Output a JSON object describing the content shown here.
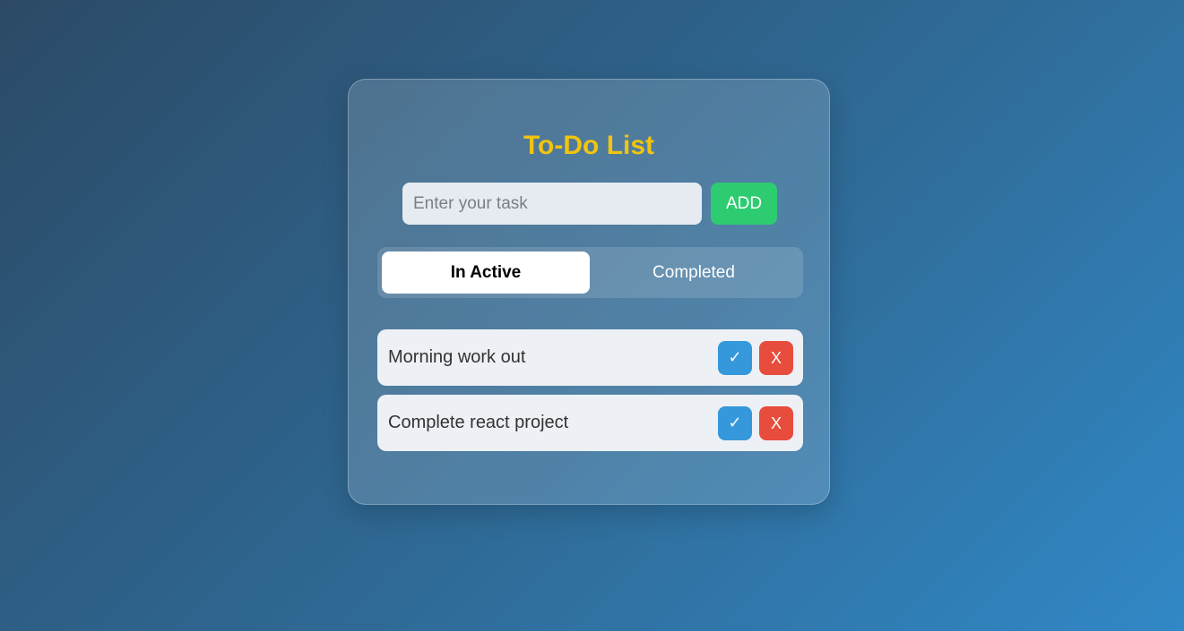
{
  "app": {
    "title": "To-Do List"
  },
  "input": {
    "placeholder": "Enter your task",
    "value": ""
  },
  "add_button": {
    "label": "ADD"
  },
  "tabs": [
    {
      "label": "In Active",
      "selected": true
    },
    {
      "label": "Completed",
      "selected": false
    }
  ],
  "tasks": [
    {
      "text": "Morning work out",
      "done_icon": "check-icon",
      "done_label": "✓",
      "delete_label": "X"
    },
    {
      "text": "Complete react project",
      "done_icon": "check-icon",
      "done_label": "✓",
      "delete_label": "X"
    }
  ],
  "colors": {
    "title": "#f1c40f",
    "add": "#2ecc71",
    "done": "#3498db",
    "delete": "#e74c3c"
  }
}
